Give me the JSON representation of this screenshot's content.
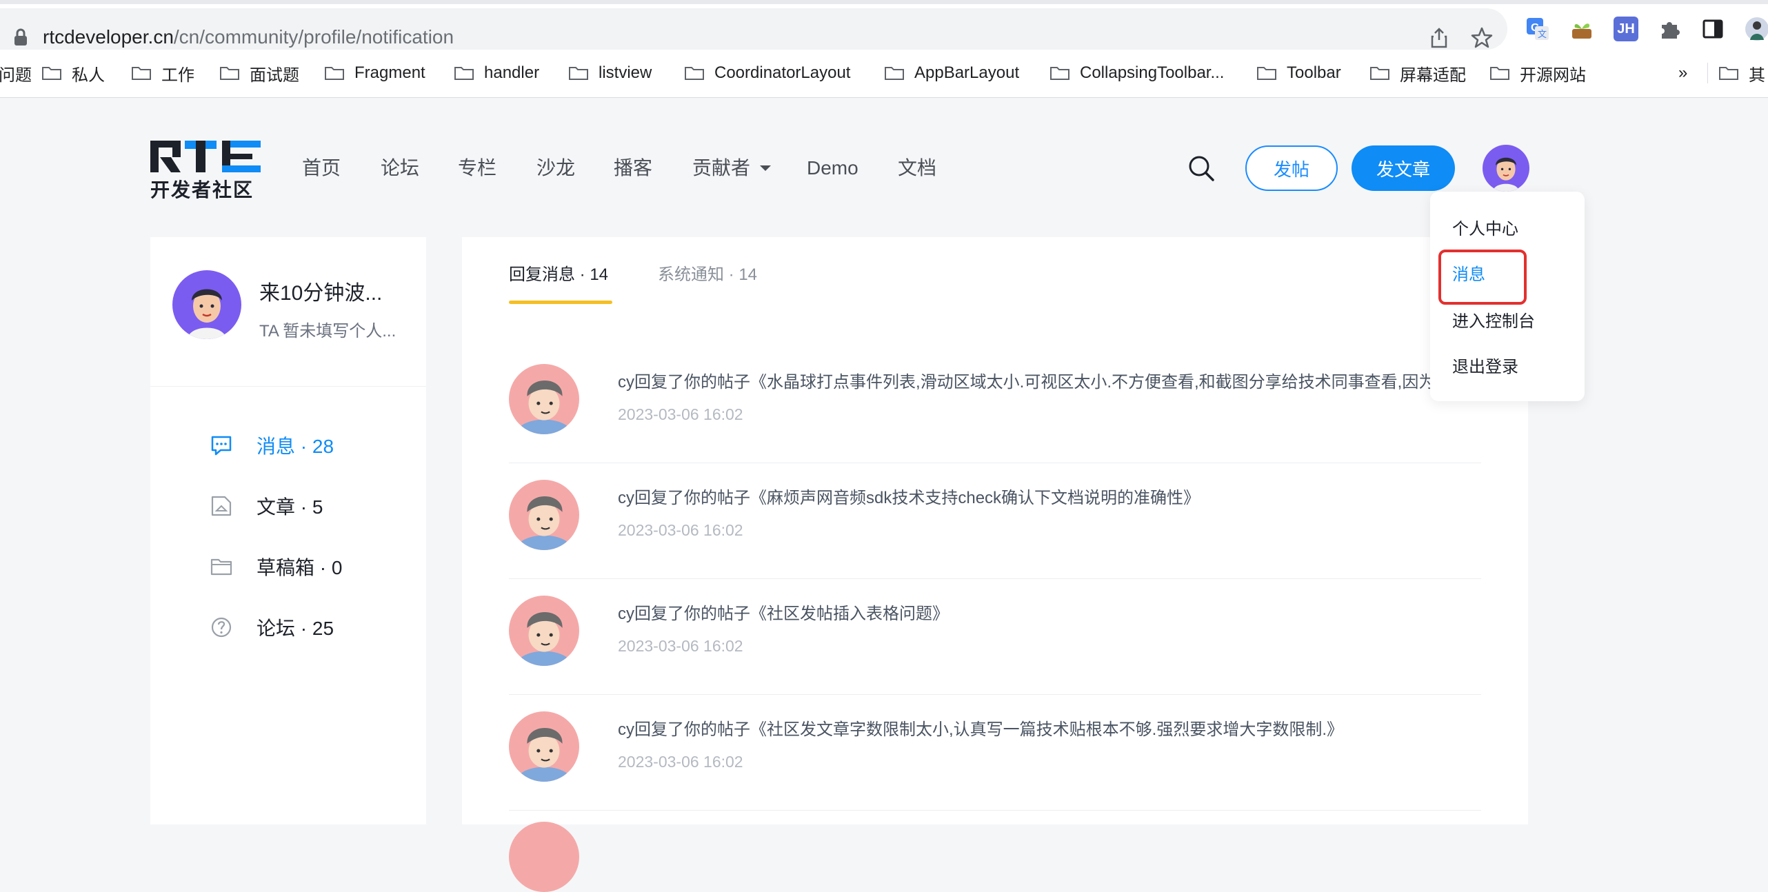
{
  "browser": {
    "url_host": "rtcdeveloper.cn",
    "url_path": "/cn/community/profile/notification",
    "extensions": [
      "translate-extension-icon",
      "plant-extension-icon",
      "jh-extension-icon",
      "puzzle-extension-icon",
      "sidebar-toggle-icon",
      "profile-icon"
    ],
    "ext_jh_label": "JH",
    "bookmarks": [
      "问题",
      "私人",
      "工作",
      "面试题",
      "Fragment",
      "handler",
      "listview",
      "CoordinatorLayout",
      "AppBarLayout",
      "CollapsingToolbar...",
      "Toolbar",
      "屏幕适配",
      "开源网站"
    ],
    "bookmarks_more": "»",
    "bookmarks_other": "其"
  },
  "header": {
    "logo_text": "开发者社区",
    "nav": [
      "首页",
      "论坛",
      "专栏",
      "沙龙",
      "播客",
      "贡献者",
      "Demo",
      "文档"
    ],
    "post_button": "发帖",
    "article_button": "发文章"
  },
  "profile": {
    "name": "来10分钟波...",
    "bio": "TA 暂未填写个人..."
  },
  "sidebar": {
    "items": [
      {
        "label": "消息 · 28",
        "icon": "message-icon",
        "active": true
      },
      {
        "label": "文章 · 5",
        "icon": "article-icon",
        "active": false
      },
      {
        "label": "草稿箱 · 0",
        "icon": "folder-icon",
        "active": false
      },
      {
        "label": "论坛 · 25",
        "icon": "question-icon",
        "active": false
      }
    ]
  },
  "tabs": {
    "reply": "回复消息 · 14",
    "system": "系统通知 · 14"
  },
  "messages": [
    {
      "text": "cy回复了你的帖子《水晶球打点事件列表,滑动区域太小.可视区太小.不方便查看,和截图分享给技术同事查看,因为",
      "time": "2023-03-06 16:02"
    },
    {
      "text": "cy回复了你的帖子《麻烦声网音频sdk技术支持check确认下文档说明的准确性》",
      "time": "2023-03-06 16:02"
    },
    {
      "text": "cy回复了你的帖子《社区发帖插入表格问题》",
      "time": "2023-03-06 16:02"
    },
    {
      "text": "cy回复了你的帖子《社区发文章字数限制太小,认真写一篇技术贴根本不够.强烈要求增大字数限制.》",
      "time": "2023-03-06 16:02"
    }
  ],
  "dropdown": {
    "items": [
      "个人中心",
      "消息",
      "进入控制台",
      "退出登录"
    ]
  },
  "colors": {
    "brand_blue": "#0f8cf5",
    "tab_underline": "#f5bf24",
    "highlight_red": "#e2302f"
  }
}
